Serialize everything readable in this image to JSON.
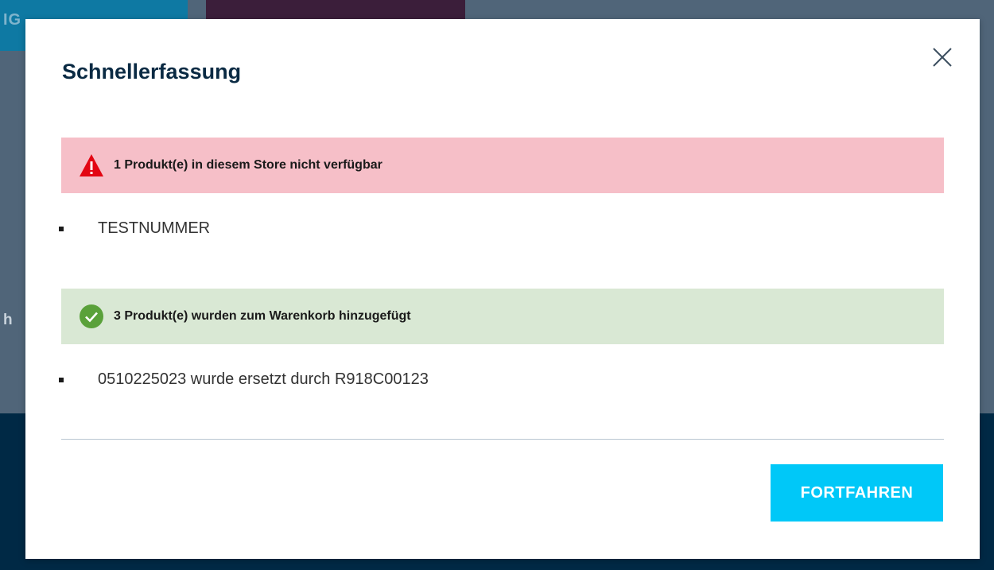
{
  "background": {
    "button_partial_label": "IG",
    "edge_text": "h"
  },
  "modal": {
    "title": "Schnellerfassung",
    "close_icon": "close-icon",
    "error_alert": {
      "icon": "warning-triangle-icon",
      "message": "1 Produkt(e) in diesem Store nicht verfügbar",
      "color": "#f6bfc8",
      "items": [
        "TESTNUMMER"
      ]
    },
    "success_alert": {
      "icon": "check-circle-icon",
      "message": "3 Produkt(e) wurden zum Warenkorb hinzugefügt",
      "color": "#d9e8d4",
      "items": [
        "0510225023 wurde ersetzt durch R918C00123"
      ]
    },
    "continue_button": "FORTFAHREN",
    "accent_color": "#00c8f8"
  }
}
